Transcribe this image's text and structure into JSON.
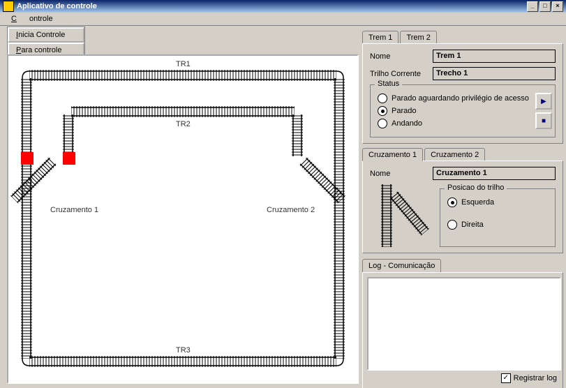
{
  "title": "Aplicativo de controle",
  "menu": {
    "controle": "Controle"
  },
  "toolbar": {
    "start": "Inicia Controle",
    "stop": "Para controle"
  },
  "track": {
    "labels": {
      "tr1": "TR1",
      "tr2": "TR2",
      "tr3": "TR3",
      "c1": "Cruzamento 1",
      "c2": "Cruzamento 2"
    }
  },
  "trainPanel": {
    "tabs": [
      "Trem 1",
      "Trem 2"
    ],
    "activeTab": 0,
    "nameLabel": "Nome",
    "nameValue": "Trem 1",
    "trilhoLabel": "Trilho Corrente",
    "trilhoValue": "Trecho 1",
    "statusLegend": "Status",
    "statusOptions": [
      "Parado aguardando privilégio de acesso",
      "Parado",
      "Andando"
    ],
    "statusSelected": 1
  },
  "cruzPanel": {
    "tabs": [
      "Cruzamento 1",
      "Cruzamento 2"
    ],
    "activeTab": 0,
    "nameLabel": "Nome",
    "nameValue": "Cruzamento 1",
    "posLegend": "Posicao do trilho",
    "posOptions": [
      "Esquerda",
      "Direita"
    ],
    "posSelected": 0
  },
  "log": {
    "tab": "Log - Comunicação",
    "registrar": "Registrar log",
    "registrarChecked": true
  }
}
